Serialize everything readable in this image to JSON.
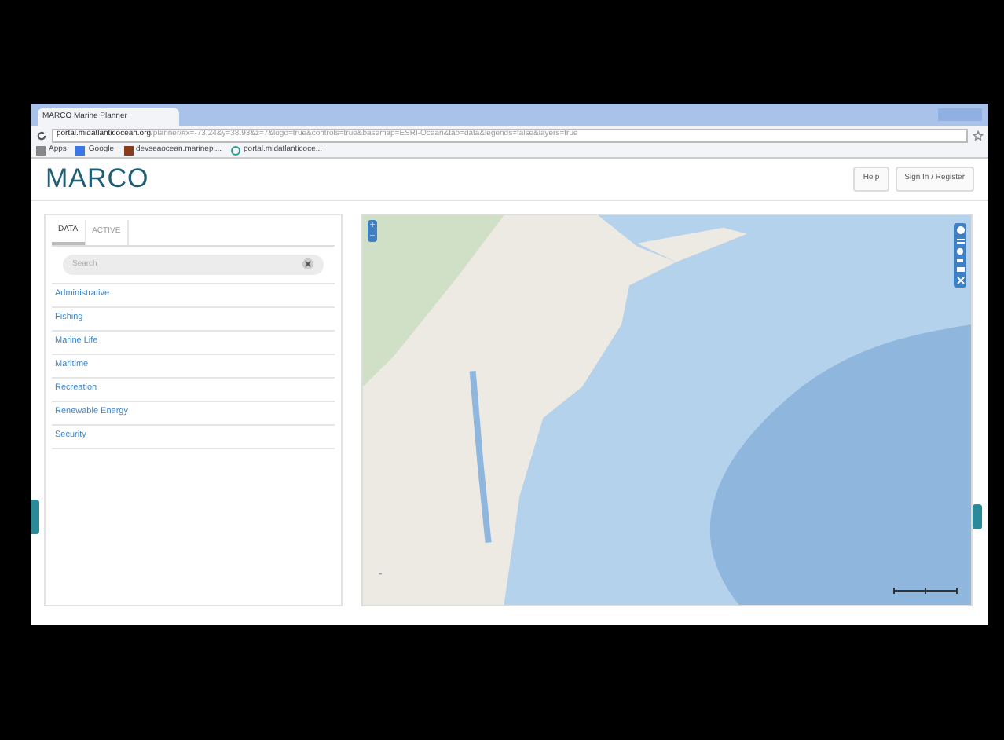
{
  "browser": {
    "tab_title": "MARCO Marine Planner",
    "url_host": "portal.midatlanticocean.org",
    "url_rest": "/planner/#x=-73.24&y=38.93&z=7&logo=true&controls=true&basemap=ESRI-Ocean&tab=data&legends=false&layers=true",
    "bookmarks": [
      {
        "label": "Apps",
        "kind": "apps"
      },
      {
        "label": "Google",
        "kind": "blue"
      },
      {
        "label": "devseaocean.marinepl...",
        "kind": "brown"
      },
      {
        "label": "portal.midatlanticoce...",
        "kind": "pin"
      }
    ]
  },
  "header": {
    "logo": "MARCO",
    "buttons": [
      "Help",
      "Sign In / Register"
    ]
  },
  "sidebar": {
    "tabs": [
      {
        "label": "DATA",
        "selected": true
      },
      {
        "label": "ACTIVE",
        "selected": false
      }
    ],
    "search": {
      "placeholder": "Search"
    },
    "categories": [
      "Administrative",
      "Fishing",
      "Marine Life",
      "Maritime",
      "Recreation",
      "Renewable Energy",
      "Security"
    ]
  },
  "map": {
    "zoom_buttons": [
      "+",
      "−"
    ]
  }
}
